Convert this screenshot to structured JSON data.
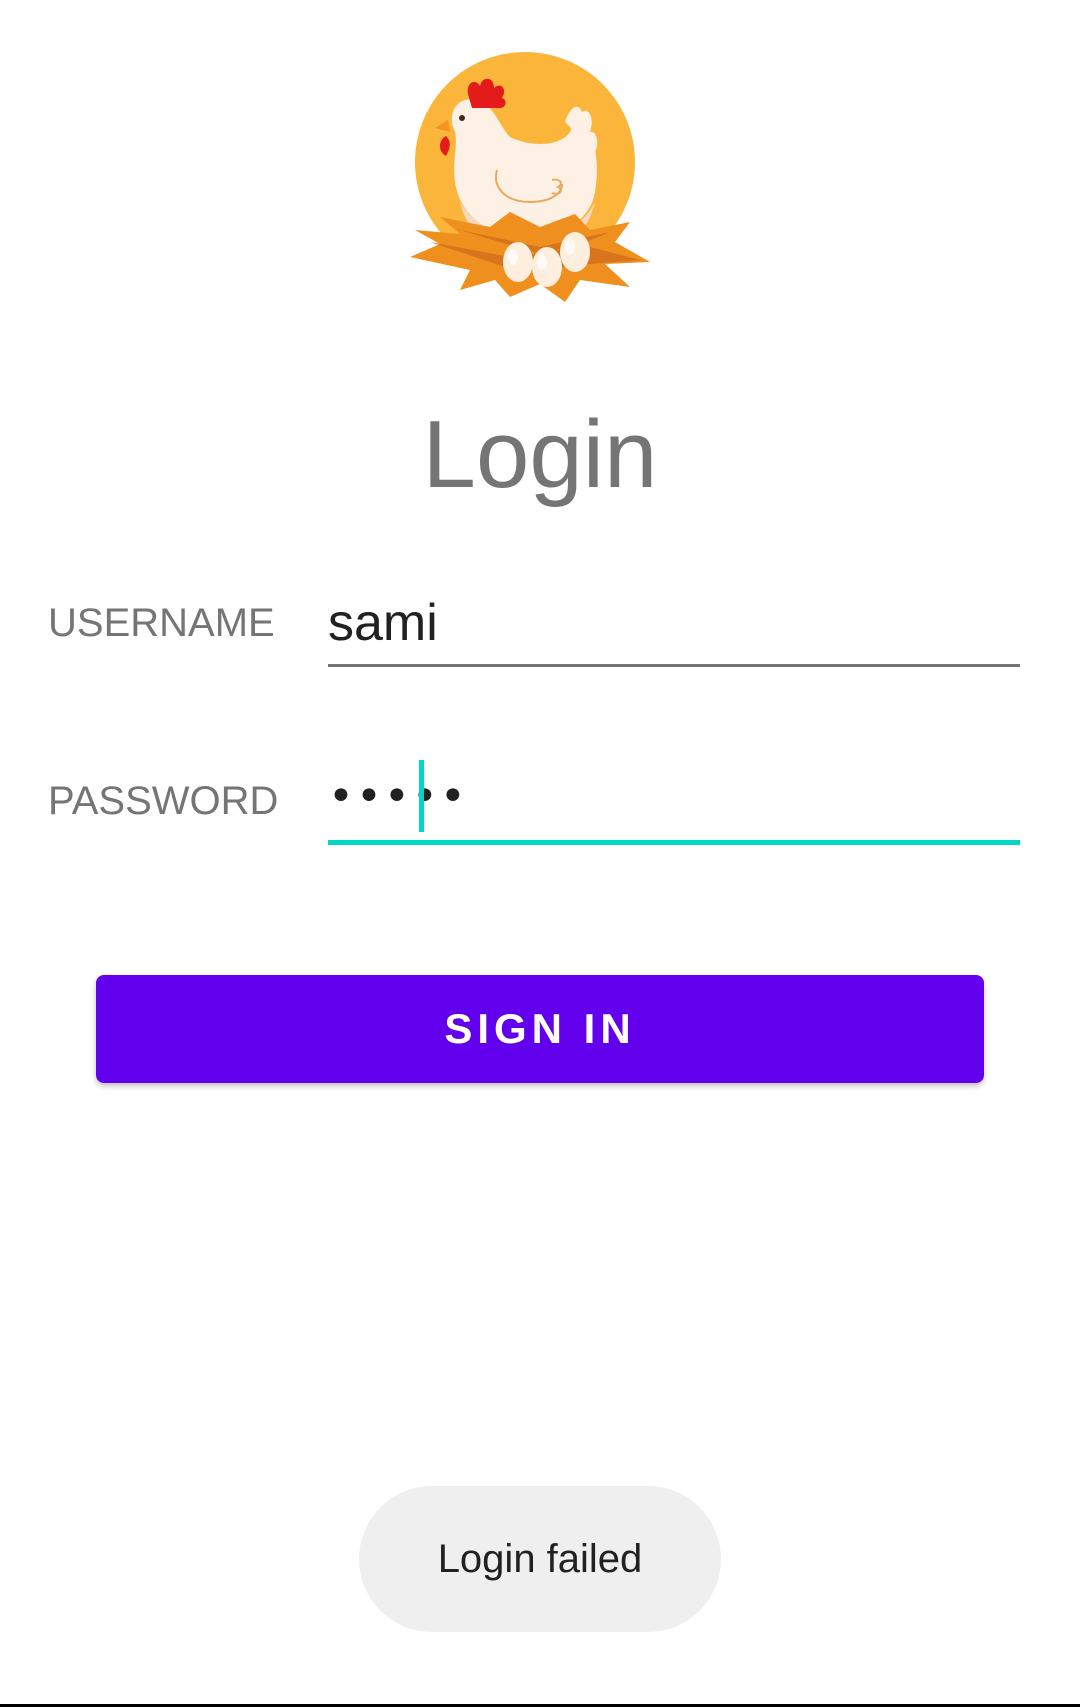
{
  "app": {
    "logo_icon": "hen-on-nest-logo"
  },
  "header": {
    "title": "Login"
  },
  "form": {
    "username_label": "USERNAME",
    "username_value": "sami",
    "password_label": "PASSWORD",
    "password_value": "•••••"
  },
  "actions": {
    "sign_in_label": "SIGN IN"
  },
  "toast": {
    "message": "Login failed"
  },
  "colors": {
    "accent": "#6200ee",
    "focus": "#00d7c4",
    "logo_background": "#fbb53b",
    "nest": "#ef8f1e"
  }
}
